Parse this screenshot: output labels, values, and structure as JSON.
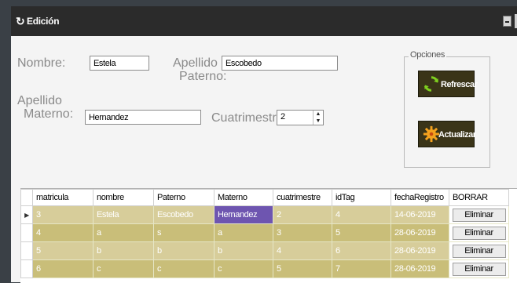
{
  "window": {
    "title": "Edición"
  },
  "form": {
    "nombre_label": "Nombre:",
    "nombre_value": "Estela",
    "apellido_paterno_label_1": "Apellido",
    "apellido_paterno_label_2": "Paterno:",
    "apellido_paterno_value": "Escobedo",
    "apellido_materno_label_1": "Apellido",
    "apellido_materno_label_2": "Materno:",
    "apellido_materno_value": "Hernandez",
    "cuatrimestre_label": "Cuatrimestre:",
    "cuatrimestre_value": "2"
  },
  "opciones": {
    "label": "Opciones",
    "refrescar_label": "Refrescar",
    "actualizar_label": "Actualizar"
  },
  "table": {
    "columns": [
      "matricula",
      "nombre",
      "Paterno",
      "Materno",
      "cuatrimestre",
      "idTag",
      "fechaRegistro",
      "BORRAR"
    ],
    "rows": [
      {
        "matricula": "3",
        "nombre": "Estela",
        "paterno": "Escobedo",
        "materno": "Hernandez",
        "cuatrimestre": "2",
        "idTag": "4",
        "fechaRegistro": "14-06-2019",
        "borrar": "Eliminar"
      },
      {
        "matricula": "4",
        "nombre": "a",
        "paterno": "s",
        "materno": "a",
        "cuatrimestre": "3",
        "idTag": "5",
        "fechaRegistro": "28-06-2019",
        "borrar": "Eliminar"
      },
      {
        "matricula": "5",
        "nombre": "b",
        "paterno": "b",
        "materno": "b",
        "cuatrimestre": "4",
        "idTag": "6",
        "fechaRegistro": "28-06-2019",
        "borrar": "Eliminar"
      },
      {
        "matricula": "6",
        "nombre": "c",
        "paterno": "c",
        "materno": "c",
        "cuatrimestre": "5",
        "idTag": "7",
        "fechaRegistro": "28-06-2019",
        "borrar": "Eliminar"
      }
    ],
    "selected_row": 0,
    "selected_column": "materno"
  },
  "colors": {
    "titlebar": "#2b2b2b",
    "row_light": "#d7cd9a",
    "row_dark": "#c9be79",
    "selected_cell": "#6e55b0",
    "button_bg": "#3a3418"
  },
  "icons": {
    "window": "refresh-icon",
    "refrescar": "refresh-icon",
    "actualizar": "gear-icon",
    "row_selector": "current-row-arrow-icon"
  }
}
